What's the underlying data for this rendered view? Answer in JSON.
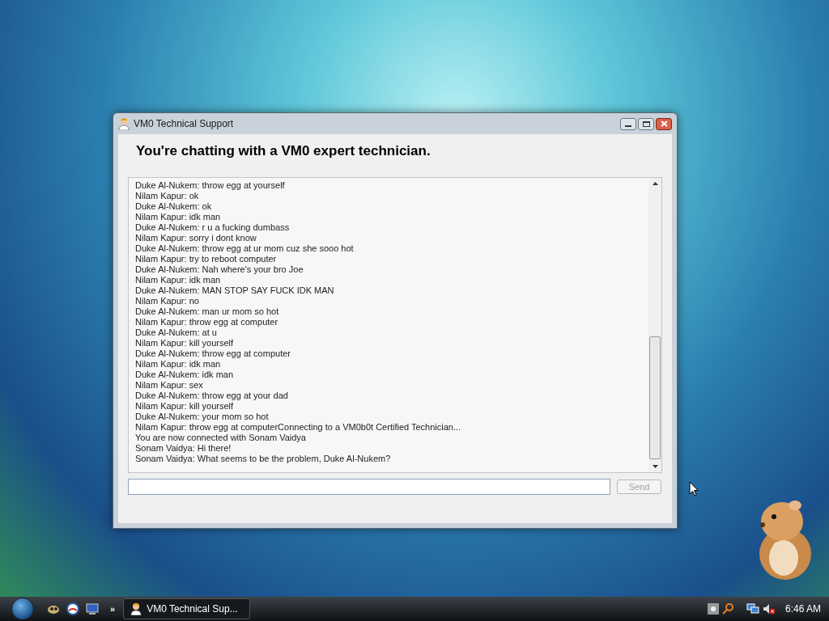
{
  "window": {
    "title": "VM0 Technical Support",
    "heading": "You're chatting with a VM0 expert technician."
  },
  "chat": {
    "lines": [
      "Duke Al-Nukem: throw egg at yourself",
      "Nilam Kapur: ok",
      "Duke Al-Nukem: ok",
      "Nilam Kapur: idk man",
      "Duke Al-Nukem: r u a fucking dumbass",
      "Nilam Kapur: sorry i dont know",
      "Duke Al-Nukem: throw egg at ur mom cuz she sooo hot",
      "Nilam Kapur: try to reboot computer",
      "Duke Al-Nukem: Nah where's your bro Joe",
      "Nilam Kapur: idk man",
      "Duke Al-Nukem: MAN STOP SAY FUCK IDK MAN",
      "Nilam Kapur: no",
      "Duke Al-Nukem: man ur mom so hot",
      "Nilam Kapur: throw egg at computer",
      "Duke Al-Nukem: at u",
      "Nilam Kapur: kill yourself",
      "Duke Al-Nukem: throw egg at computer",
      "Nilam Kapur: idk man",
      "Duke Al-Nukem: idk man",
      "Nilam Kapur: sex",
      "Duke Al-Nukem: throw egg at your dad",
      "Nilam Kapur: kill yourself",
      "Duke Al-Nukem: your mom so hot",
      "Nilam Kapur: throw egg at computerConnecting to a VM0b0t Certified Technician...",
      "You are now connected with Sonam Vaidya",
      "Sonam Vaidya: Hi there!",
      "Sonam Vaidya: What seems to be the problem, Duke Al-Nukem?"
    ]
  },
  "send_button": {
    "label": "Send",
    "disabled": true
  },
  "taskbar": {
    "window_button": "VM0 Technical Sup...",
    "overflow": "»",
    "clock": "6:46 AM"
  }
}
